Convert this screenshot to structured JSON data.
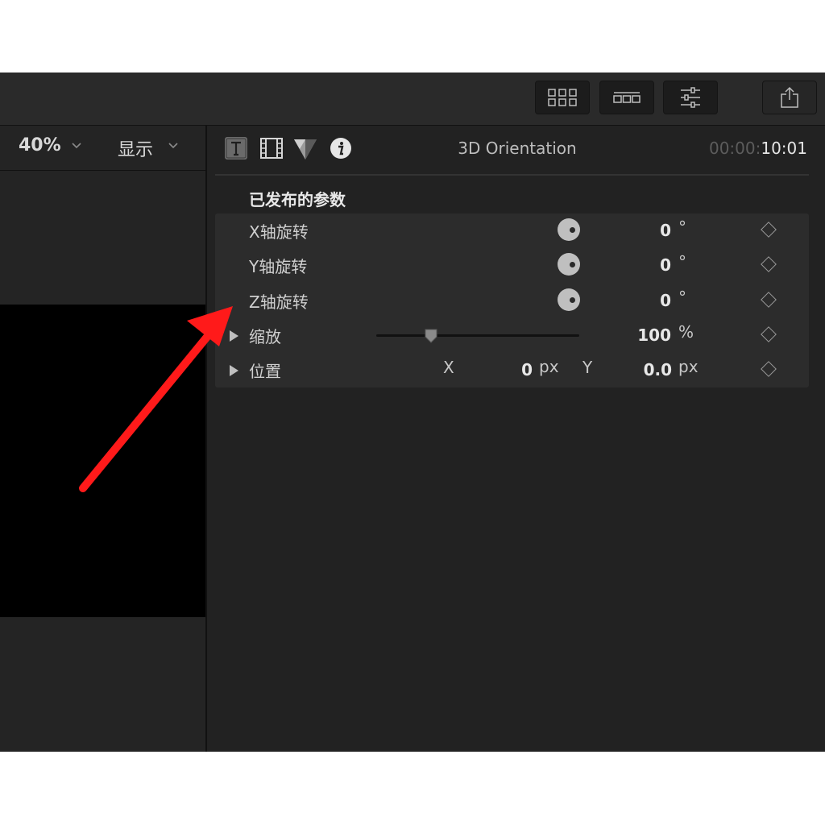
{
  "toolbar": {
    "buttons": [
      {
        "name": "browser-view-icon"
      },
      {
        "name": "timeline-view-icon"
      },
      {
        "name": "inspector-sliders-icon"
      },
      {
        "name": "share-icon"
      }
    ]
  },
  "viewer": {
    "zoom_label": "40%",
    "display_label": "显示"
  },
  "inspector": {
    "tabs": [
      {
        "name": "text-tab-icon"
      },
      {
        "name": "video-tab-icon"
      },
      {
        "name": "color-tab-icon"
      },
      {
        "name": "info-tab-icon"
      }
    ],
    "title": "3D Orientation",
    "timecode_dim": "00:00:",
    "timecode_main": "10:01",
    "section_heading": "已发布的参数",
    "params": {
      "x_rotation": {
        "label": "X轴旋转",
        "value": "0",
        "unit": "°"
      },
      "y_rotation": {
        "label": "Y轴旋转",
        "value": "0",
        "unit": "°"
      },
      "z_rotation": {
        "label": "Z轴旋转",
        "value": "0",
        "unit": "°"
      },
      "scale": {
        "label": "缩放",
        "value": "100",
        "unit": "%",
        "slider_fraction": 0.27
      },
      "position": {
        "label": "位置",
        "x_label": "X",
        "x_value": "0",
        "x_unit": "px",
        "y_label": "Y",
        "y_value": "0.0",
        "y_unit": "px"
      }
    }
  },
  "colors": {
    "background": "#1e1e1e",
    "panel": "#2c2c2c",
    "annotation_arrow": "#ff1a1a"
  }
}
